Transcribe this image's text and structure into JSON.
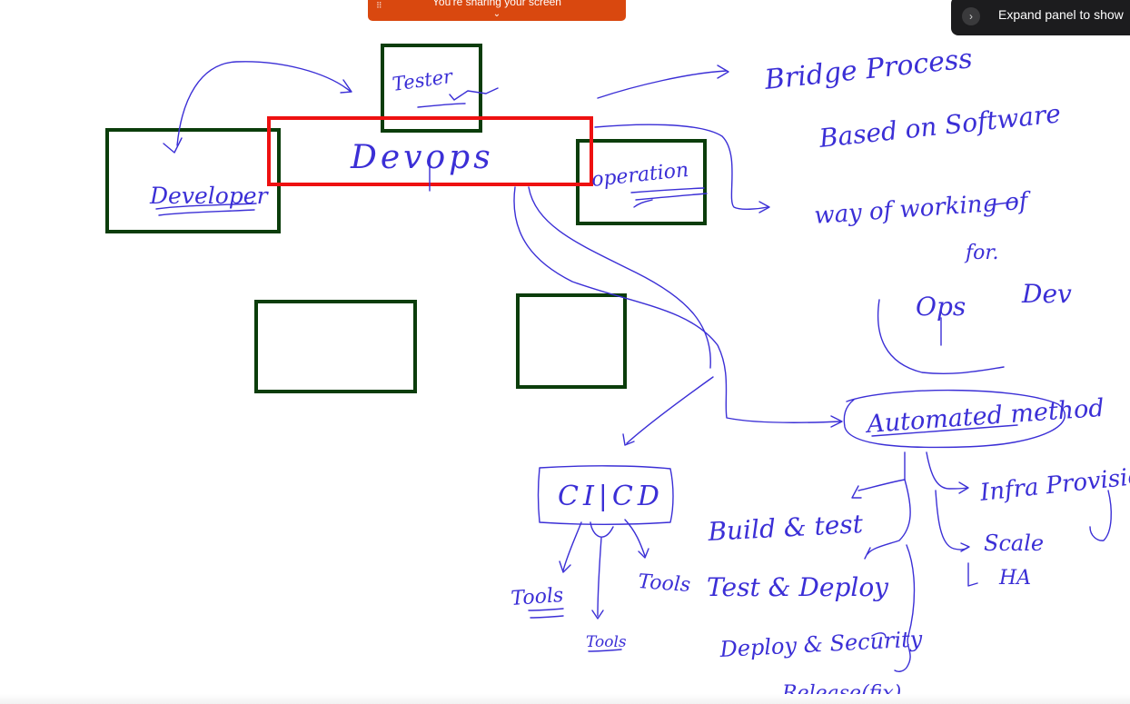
{
  "share_banner": {
    "text": "You're sharing your screen",
    "chevron": "⌄",
    "grip": "⠿"
  },
  "panel_toggle": {
    "label": "Expand panel to show",
    "chevron": "›"
  },
  "board": {
    "developer": "Developer",
    "tester": "Tester",
    "devops": "Devops",
    "operation": "operation",
    "bridge_process": "Bridge Process",
    "based_on_software": "Based on Software",
    "way_of_working": "way of working of",
    "for": "for.",
    "ops": "Ops",
    "dev": "Dev",
    "automated_method": "Automated method",
    "ci_cd": "CI|CD",
    "tools_left": "Tools",
    "tools_right": "Tools",
    "tools_bottom": "Tools",
    "build_test": "Build & test",
    "test_deploy": "Test & Deploy",
    "deploy_security": "Deploy & Security",
    "release_fix": "Release(fix)",
    "infra_provisioning": "Infra Provisioning",
    "scale": "Scale",
    "ha": "HA"
  },
  "colors": {
    "ink": "#3b2fd6",
    "box_green": "#0b3d0b",
    "box_red": "#ee1111",
    "banner": "#d9480f",
    "panel": "#1c1c1e"
  }
}
